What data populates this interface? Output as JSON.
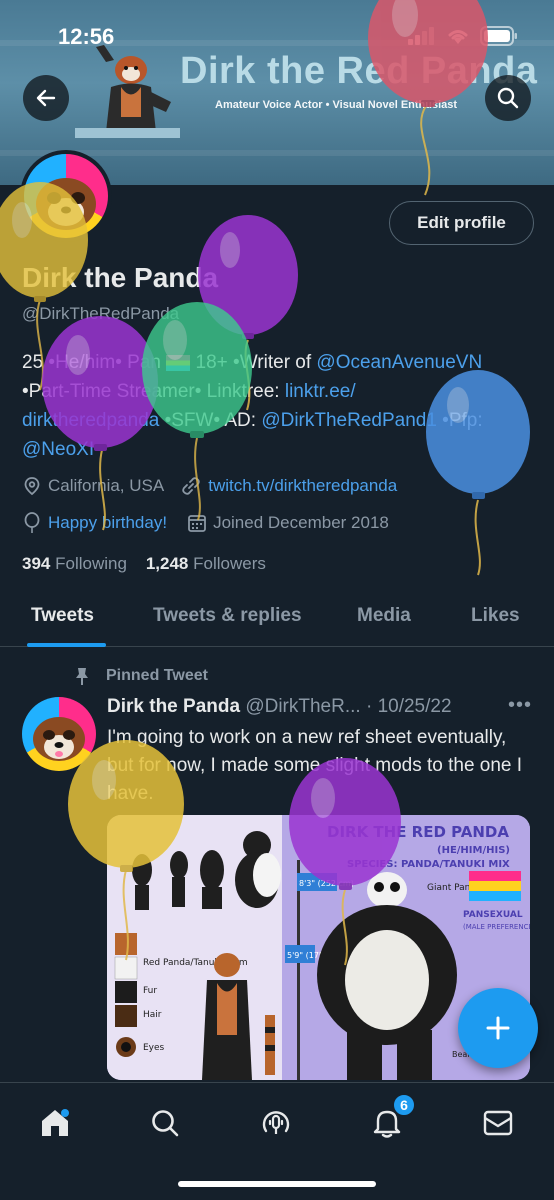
{
  "status_bar": {
    "time": "12:56"
  },
  "banner": {
    "title": "Dirk the Red Panda",
    "subtitle": "Amateur Voice Actor • Visual Novel Enthusiast"
  },
  "profile": {
    "edit_label": "Edit profile",
    "name": "Dirk the Panda",
    "handle": "@DirkTheRedPanda",
    "bio": {
      "l1a": "25 •He/him• Pan ",
      "l1b": " 18+ •Writer of ",
      "l1link": "@OceanAvenueVN",
      "l2a": "•Part-Time Streamer• Linktree: ",
      "l2link": "linktr.ee/",
      "l3link": "dirktheredpanda",
      "l3a": " •SFW• AD: ",
      "l3link2": "@DirkTheRedPand1",
      "l3b": " •Pfp:",
      "l4link": "@NeoXI"
    },
    "location": "California, USA",
    "website": "twitch.tv/dirktheredpanda",
    "birthday": "Happy birthday!",
    "joined": "Joined December 2018",
    "following_count": "394",
    "following_label": "Following",
    "followers_count": "1,248",
    "followers_label": "Followers"
  },
  "tabs": [
    "Tweets",
    "Tweets & replies",
    "Media",
    "Likes"
  ],
  "pinned_tweet": {
    "pinned_label": "Pinned Tweet",
    "author": "Dirk the Panda",
    "handle": "@DirkTheR...",
    "date": "· 10/25/22",
    "text": "I'm going to work on a new ref sheet eventually, but for now, I made some slight mods to the one I have."
  },
  "ref_sheet": {
    "title": "DIRK THE RED PANDA",
    "pronouns": "(HE/HIM/HIS)",
    "species_label": "SPECIES:",
    "species": "PANDA/TANUKI MIX",
    "pansexual": "PANSEXUAL",
    "pansexual_note": "(MALE PREFERENCE)",
    "height1": "8'3\" (252 cm)",
    "height2": "5'9\" (175 cm)",
    "giant_panda": "Giant Panda Form",
    "red_panda": "Red Panda/Tanuki Form",
    "fur": "Fur",
    "hair": "Hair",
    "eyes": "Eyes",
    "bear_tail": "Bear Tail"
  },
  "notifications_badge": "6",
  "colors": {
    "background": "#15202b",
    "accent": "#1d9bf0",
    "link": "#4ca0eb",
    "muted": "#8b98a5"
  },
  "icons": [
    "back-arrow-icon",
    "search-icon",
    "location-pin-icon",
    "link-icon",
    "balloon-icon",
    "calendar-icon",
    "pin-icon",
    "more-icon",
    "compose-plus-icon",
    "home-icon",
    "explore-icon",
    "spaces-icon",
    "bell-icon",
    "mail-icon"
  ]
}
